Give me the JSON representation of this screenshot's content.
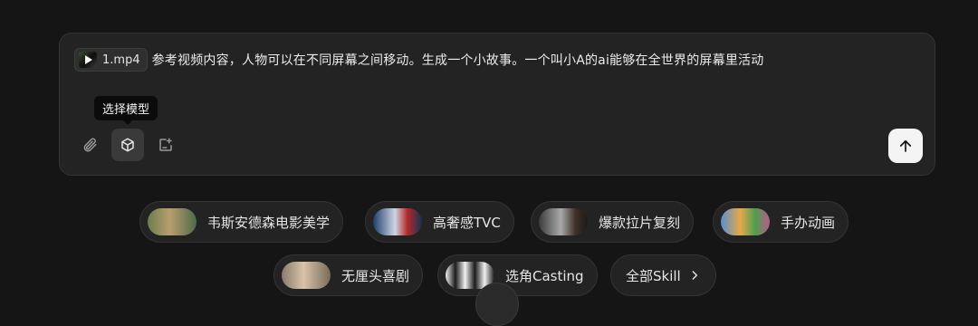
{
  "composer": {
    "attachment": {
      "filename": "1.mp4",
      "icon": "video-play-icon"
    },
    "prompt": "参考视频内容，人物可以在不同屏幕之间移动。生成一个小故事。一个叫小A的ai能够在全世界的屏幕里活动",
    "tooltip": "选择模型",
    "tools": [
      {
        "name": "attach",
        "icon": "paperclip-icon"
      },
      {
        "name": "model-select",
        "icon": "cube-icon",
        "active": true
      },
      {
        "name": "edit",
        "icon": "edit-icon"
      }
    ],
    "send_icon": "arrow-up-icon"
  },
  "skills": [
    {
      "label": "韦斯安德森电影美学"
    },
    {
      "label": "高奢感TVC"
    },
    {
      "label": "爆款拉片复刻"
    },
    {
      "label": "手办动画"
    },
    {
      "label": "无厘头喜剧"
    },
    {
      "label": "选角Casting"
    }
  ],
  "all_skills": {
    "label": "全部Skill",
    "icon": "chevron-right-icon"
  },
  "colors": {
    "background": "#151515",
    "panel": "#232323",
    "send": "#f4f4f4"
  }
}
